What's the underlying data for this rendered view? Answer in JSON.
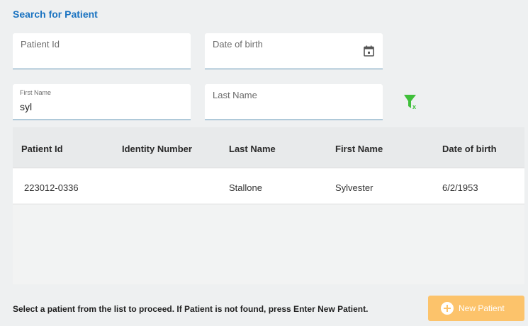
{
  "search": {
    "title": "Search for Patient",
    "patient_id_label": "Patient Id",
    "patient_id_value": "",
    "dob_label": "Date of birth",
    "dob_value": "",
    "first_name_label": "First Name",
    "first_name_value": "syl",
    "last_name_label": "Last Name",
    "last_name_value": ""
  },
  "icons": {
    "calendar": "calendar-icon",
    "clear_filter": "clear-filter-icon",
    "plus": "plus-circle-icon"
  },
  "table": {
    "headers": [
      "Patient Id",
      "Identity Number",
      "Last Name",
      "First Name",
      "Date of birth"
    ],
    "rows": [
      [
        "223012-0336",
        "",
        "Stallone",
        "Sylvester",
        "6/2/1953"
      ]
    ]
  },
  "footer": {
    "hint": "Select a patient from the list to proceed. If Patient is not found, press Enter New Patient.",
    "new_patient_label": "New Patient"
  },
  "colors": {
    "title": "#1a73c1",
    "accent_button": "#fcc36b",
    "filter_icon": "#3fbf3a"
  }
}
